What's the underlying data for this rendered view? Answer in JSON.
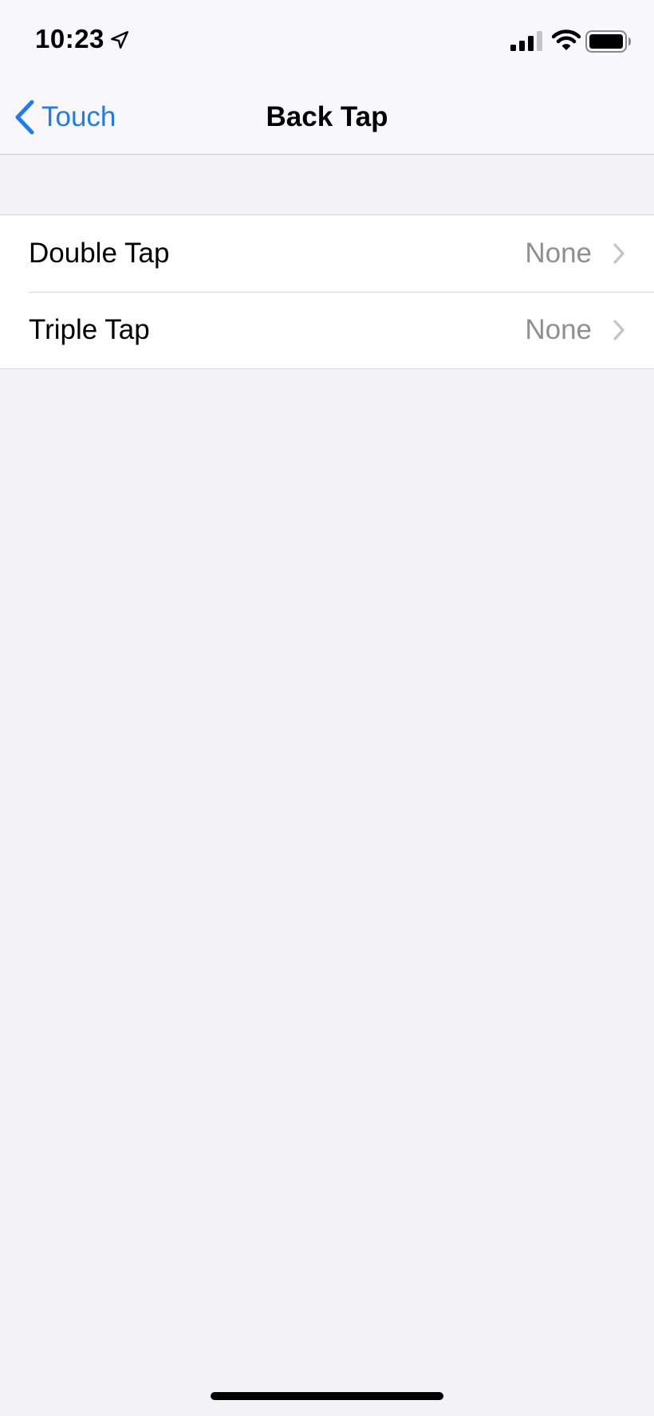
{
  "status_bar": {
    "time": "10:23",
    "icons": [
      "location-arrow-icon",
      "cellular-signal-icon",
      "wifi-icon",
      "battery-icon"
    ]
  },
  "nav": {
    "back_label": "Touch",
    "title": "Back Tap"
  },
  "settings": {
    "rows": [
      {
        "label": "Double Tap",
        "value": "None"
      },
      {
        "label": "Triple Tap",
        "value": "None"
      }
    ]
  },
  "colors": {
    "accent": "#1f7cf0",
    "background": "#f2f2f7",
    "secondary_text": "#8e8e93"
  }
}
